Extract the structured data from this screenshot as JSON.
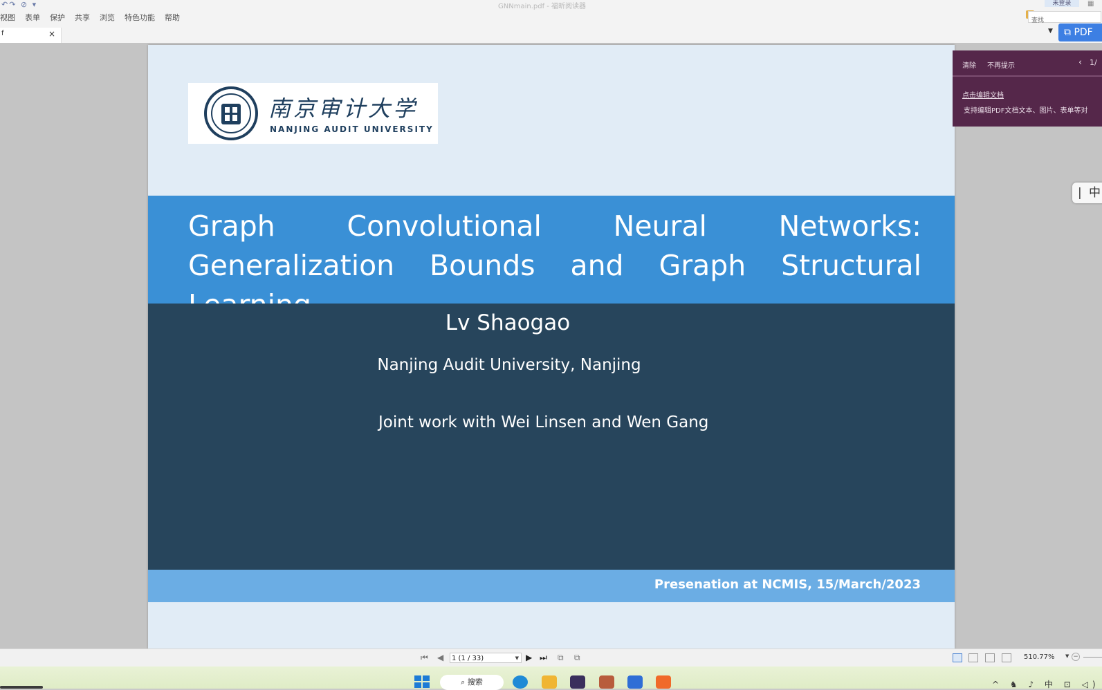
{
  "window": {
    "title": "GNNmain.pdf - 福昕阅读器",
    "quick_access": "↶↷ ⊘ ▾"
  },
  "menu": {
    "items": [
      "视图",
      "表单",
      "保护",
      "共享",
      "浏览",
      "特色功能",
      "帮助"
    ],
    "login_label": "未登录",
    "search_placeholder": "查找",
    "pdf_button_label": "PDF"
  },
  "tab": {
    "name": "f",
    "close_glyph": "×"
  },
  "slide": {
    "logo_cn": "南京审计大学",
    "logo_en": "NANJING AUDIT UNIVERSITY",
    "title": "Graph Convolutional Neural Networks: Generalization Bounds and Graph Structural Learning",
    "author": "Lv Shaogao",
    "affiliation": "Nanjing Audit University, Nanjing",
    "coauthors": "Joint work with Wei Linsen and Wen Gang",
    "footer": "Presenation at NCMIS, 15/March/2023",
    "colors": {
      "background": "#e1ecf6",
      "title_band": "#3a90d6",
      "author_band": "#27455c",
      "footer_band": "#6bade4"
    }
  },
  "tip_panel": {
    "clear_label": "清除",
    "no_show_label": "不再提示",
    "page": "1/",
    "link_text": "点击编辑文档",
    "description": "支持编辑PDF文档文本、图片、表单等对"
  },
  "ime": {
    "bar_glyph": "|",
    "lang": "中"
  },
  "statusbar": {
    "page_value": "1 (1 / 33)",
    "zoom": "510.77%"
  },
  "taskbar": {
    "search_label": "搜索",
    "tray": "^ ♞ ♪ 中 ⊡ ◁)"
  }
}
